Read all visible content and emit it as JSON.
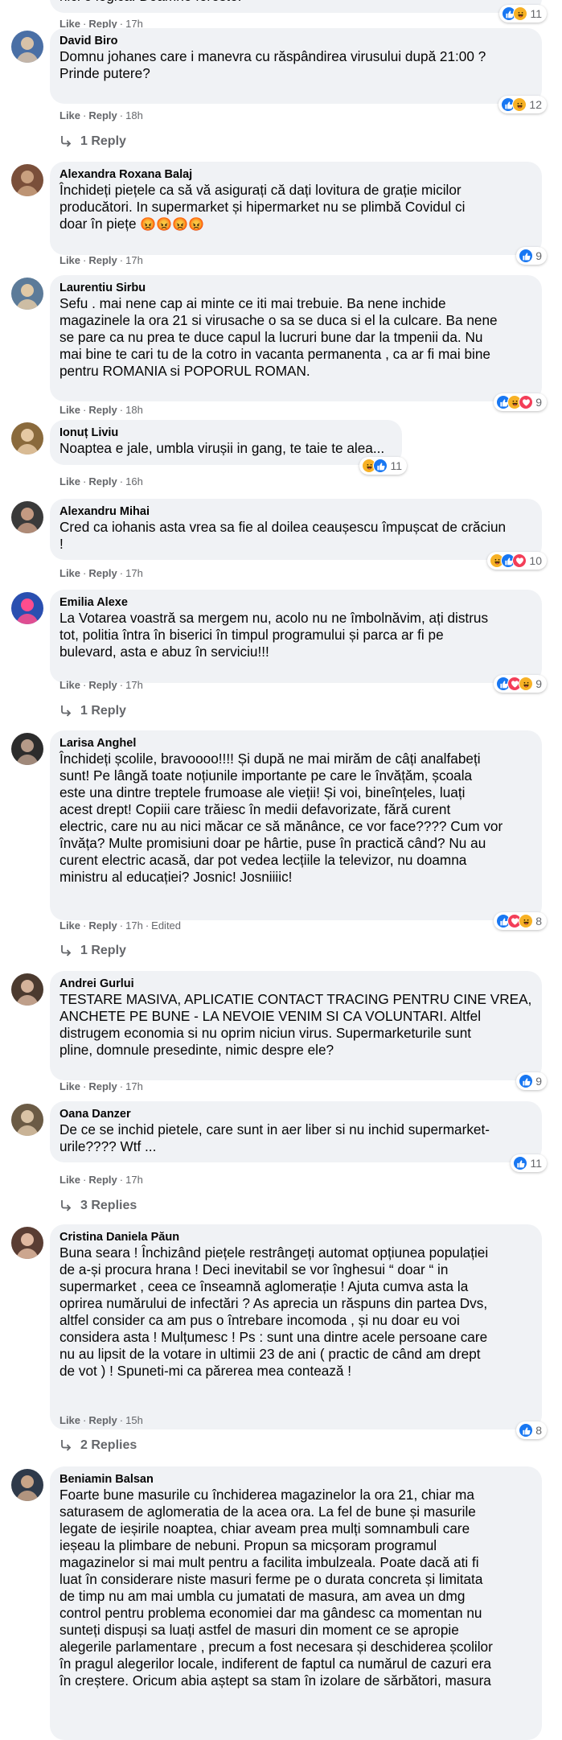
{
  "labels": {
    "like": "Like",
    "reply": "Reply",
    "dot": "·"
  },
  "top_partial": {
    "text": "nici o logica. Doamne fereste!",
    "time": "17h",
    "count": "11",
    "reactions": [
      "like-reaction-icon",
      "haha-reaction-icon"
    ]
  },
  "comments": [
    {
      "author": "David Biro",
      "text": "Domnu johanes care i manevra cu răspândirea virusului după 21:00 ?\nPrinde putere?",
      "time": "18h",
      "count": "12",
      "reactions": [
        "like-reaction-icon",
        "haha-reaction-icon"
      ],
      "replies": "1 Reply"
    },
    {
      "author": "Alexandra Roxana Balaj",
      "text": "Închideți piețele ca să vă asigurați că dați lovitura de grație micilor\nproducători. In supermarket și hipermarket nu se plimbă Covidul ci\ndoar în piețe",
      "emoji": "😡😡😡😡",
      "time": "17h",
      "count": "9",
      "reactions": [
        "like-reaction-icon"
      ]
    },
    {
      "author": "Laurentiu Sirbu",
      "text": "Sefu . mai nene cap ai minte ce iti mai trebuie. Ba nene inchide\nmagazinele la ora 21 si virusache o sa se duca si el la culcare. Ba nene\nse pare ca nu prea te duce capul la lucruri bune dar la tmpenii da. Nu\nmai bine te cari tu de la cotro in vacanta permanenta , ca ar fi mai bine\npentru ROMANIA si POPORUL ROMAN.",
      "time": "18h",
      "count": "9",
      "reactions": [
        "like-reaction-icon",
        "haha-reaction-icon",
        "love-reaction-icon"
      ]
    },
    {
      "author": "Ionuț Liviu",
      "text": "Noaptea e jale, umbla virușii in gang, te taie te alea...",
      "time": "16h",
      "count": "11",
      "reactions": [
        "haha-reaction-icon",
        "like-reaction-icon"
      ]
    },
    {
      "author": "Alexandru Mihai",
      "text": "Cred ca iohanis asta vrea sa fie al doilea ceaușescu împușcat de crăciun\n!",
      "time": "17h",
      "count": "10",
      "reactions": [
        "haha-reaction-icon",
        "like-reaction-icon",
        "love-reaction-icon"
      ]
    },
    {
      "author": "Emilia Alexe",
      "text": "La Votarea voastră sa mergem nu, acolo nu ne îmbolnăvim, ați distrus\ntot, politia întra în biserici în timpul programului și parca ar fi pe\nbulevard, asta e abuz în serviciu!!!",
      "time": "17h",
      "count": "9",
      "reactions": [
        "like-reaction-icon",
        "love-reaction-icon",
        "haha-reaction-icon"
      ],
      "replies": "1 Reply"
    },
    {
      "author": "Larisa Anghel",
      "text": "Închideți școlile, bravoooo!!!! Și după ne mai mirăm de câți analfabeți\nsunt! Pe lângă toate noțiunile importante pe care le învățăm, școala\neste una dintre treptele frumoase ale vieții! Și voi, bineînțeles, luați\nacest drept! Copiii care trăiesc în medii defavorizate, fără curent\nelectric, care nu au nici măcar ce să mănânce, ce vor face???? Cum vor\nînvăța? Multe promisiuni doar pe hârtie, puse în practică când? Nu au\ncurent electric acasă, dar pot vedea lecțiile la televizor, nu doamna\nministru al educației? Josnic! Josniiiic!",
      "time": "17h",
      "edited": "Edited",
      "count": "8",
      "reactions": [
        "like-reaction-icon",
        "love-reaction-icon",
        "haha-reaction-icon"
      ],
      "replies": "1 Reply"
    },
    {
      "author": "Andrei Gurlui",
      "text": "TESTARE MASIVA, APLICATIE CONTACT TRACING PENTRU CINE VREA,\nANCHETE PE BUNE - LA NEVOIE VENIM SI CA VOLUNTARI. Altfel\ndistrugem economia si nu oprim niciun virus. Supermarketurile sunt\npline, domnule presedinte, nimic despre ele?",
      "time": "17h",
      "count": "9",
      "reactions": [
        "like-reaction-icon"
      ]
    },
    {
      "author": "Oana Danzer",
      "text": "De ce se inchid pietele, care sunt in aer liber si nu inchid supermarket-\nurile???? Wtf ...",
      "time": "17h",
      "count": "11",
      "reactions": [
        "like-reaction-icon"
      ],
      "replies": "3 Replies"
    },
    {
      "author": "Cristina Daniela Păun",
      "text": "Buna seara ! Închizând piețele restrângeți automat opțiunea populației\nde a-și procura hrana ! Deci inevitabil se vor înghesui “ doar “ in\nsupermarket , ceea ce înseamnă aglomerație ! Ajuta cumva asta la\noprirea numărului de infectări ? As aprecia un răspuns din partea Dvs,\naltfel consider ca am pus o întrebare incomoda , și nu doar eu voi\nconsidera asta ! Mulțumesc ! Ps : sunt una dintre acele persoane care\nnu au lipsit de la votare in ultimii 23 de ani ( practic de când am drept\nde vot ) ! Spuneti-mi ca părerea mea contează !",
      "time": "15h",
      "count": "8",
      "reactions": [
        "like-reaction-icon"
      ],
      "replies": "2 Replies"
    },
    {
      "author": "Beniamin Balsan",
      "text": "Foarte bune masurile cu închiderea magazinelor la ora 21, chiar ma\nsaturasem de aglomeratia de la acea ora. La fel de bune și masurile\nlegate de ieșirile noaptea, chiar aveam prea mulți somnambuli care\nieșeau la plimbare de nebuni. Propun sa micșoram programul\nmagazinelor si mai mult pentru a facilita imbulzeala. Poate dacă ati fi\nluat în considerare niste masuri ferme pe o durata concreta și limitata\nde timp nu am mai umbla cu jumatati de masura, am avea un dmg\ncontrol pentru problema economiei dar ma gândesc ca momentan nu\nsunteți dispuși sa luați astfel de masuri din moment ce se apropie\nalegerile parlamentare , precum a fost necesara și deschiderea școlilor\nîn pragul alegerilor locale, indiferent de faptul ca numărul de cazuri era\nîn creștere. Oricum abia aștept sa stam în izolare de sărbători, masura"
    }
  ]
}
